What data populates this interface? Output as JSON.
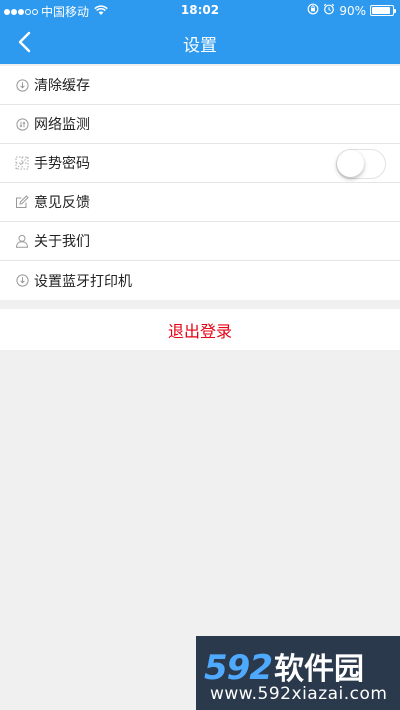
{
  "status_bar": {
    "carrier": "中国移动",
    "time": "18:02",
    "battery_text": "90%",
    "battery_level": 0.9,
    "icons": [
      "signal-dots",
      "wifi-icon",
      "lock-rotation-icon",
      "alarm-icon",
      "battery-icon"
    ]
  },
  "nav": {
    "title": "设置",
    "back_icon": "chevron-left-icon"
  },
  "settings": {
    "items": [
      {
        "label": "清除缓存",
        "icon": "clear-cache-icon"
      },
      {
        "label": "网络监测",
        "icon": "network-monitor-icon"
      },
      {
        "label": "手势密码",
        "icon": "gesture-pattern-icon",
        "toggle": false
      },
      {
        "label": "意见反馈",
        "icon": "feedback-edit-icon"
      },
      {
        "label": "关于我们",
        "icon": "user-icon"
      },
      {
        "label": "设置蓝牙打印机",
        "icon": "bluetooth-printer-icon"
      }
    ]
  },
  "logout": {
    "label": "退出登录",
    "color": "#e60012"
  },
  "watermark": {
    "logo_number": "592",
    "logo_text": "软件园",
    "url": "www.592xiazai.com"
  },
  "colors": {
    "header": "#2d9af0",
    "background": "#f0f0f0",
    "accent_watermark": "#4fa9ff"
  }
}
